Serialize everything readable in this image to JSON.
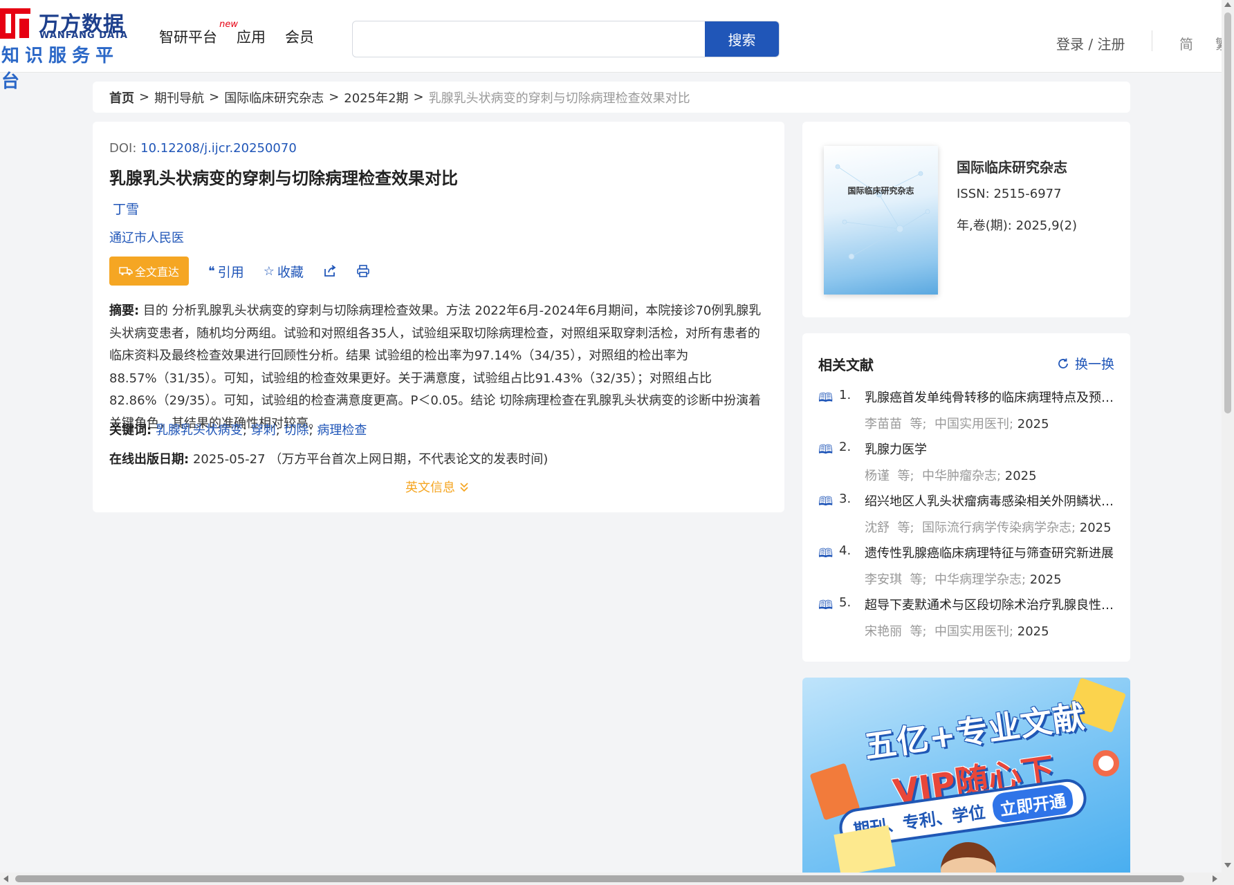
{
  "header": {
    "logo_cn": "万方数据",
    "logo_en": "WANFANG DATA",
    "logo_sub": "知识服务平台",
    "nav": [
      {
        "label": "智研平台",
        "badge": "new"
      },
      {
        "label": "应用"
      },
      {
        "label": "会员"
      }
    ],
    "search": {
      "value": "",
      "placeholder": "",
      "button": "搜索"
    },
    "login": "登录 / 注册",
    "lang_simplified": "简",
    "lang_traditional": "繁"
  },
  "breadcrumb": {
    "items": [
      "首页",
      "期刊导航",
      "国际临床研究杂志",
      "2025年2期"
    ],
    "current": "乳腺乳头状病变的穿刺与切除病理检查效果对比",
    "separator": ">"
  },
  "article": {
    "doi_label": "DOI: ",
    "doi": "10.12208/j.ijcr.20250070",
    "title": "乳腺乳头状病变的穿刺与切除病理检查效果对比",
    "author": "丁雪",
    "org": "通辽市人民医",
    "actions": {
      "fulltext": "全文直达",
      "cite": "引用",
      "favorite": "收藏"
    },
    "abstract_label": "摘要:",
    "abstract": " 目的 分析乳腺乳头状病变的穿刺与切除病理检查效果。方法 2022年6月-2024年6月期间，本院接诊70例乳腺乳头状病变患者，随机均分两组。试验和对照组各35人，试验组采取切除病理检查，对照组采取穿刺活检，对所有患者的临床资料及最终检查效果进行回顾性分析。结果 试验组的检出率为97.14%（34/35），对照组的检出率为88.57%（31/35）。可知，试验组的检查效果更好。关于满意度，试验组占比91.43%（32/35）；对照组占比82.86%（29/35）。可知，试验组的检查满意度更高。P＜0.05。结论 切除病理检查在乳腺乳头状病变的诊断中扮演着关键角色，其结果的准确性相对较高。",
    "keywords_label": "关键词:",
    "keywords": [
      "乳腺乳头状病变",
      "穿刺",
      "切除",
      "病理检查"
    ],
    "pubdate_label": "在线出版日期:",
    "pubdate": "2025-05-27",
    "pubdate_note": "（万方平台首次上网日期，不代表论文的发表时间)",
    "en_info": "英文信息"
  },
  "journal": {
    "cover_title": "国际临床研究杂志",
    "name": "国际临床研究杂志",
    "issn_label": "ISSN:",
    "issn": "2515-6977",
    "issue_label": "年,卷(期):",
    "issue": "2025,9(2)"
  },
  "related": {
    "heading": "相关文献",
    "refresh": "换一换",
    "items": [
      {
        "num": "1.",
        "title": "乳腺癌首发单纯骨转移的临床病理特点及预后分析",
        "author": "李苗苗",
        "etal": "等;",
        "source": "中国实用医刊",
        "year": "2025"
      },
      {
        "num": "2.",
        "title": "乳腺力医学",
        "author": "杨谨",
        "etal": "等;",
        "source": "中华肿瘤杂志",
        "year": "2025"
      },
      {
        "num": "3.",
        "title": "绍兴地区人乳头状瘤病毒感染相关外阴鳞状上皮病变",
        "author": "沈舒",
        "etal": "等;",
        "source": "国际流行病学传染病学杂志",
        "year": "2025"
      },
      {
        "num": "4.",
        "title": "遗传性乳腺癌临床病理特征与筛查研究新进展",
        "author": "李安琪",
        "etal": "等;",
        "source": "中华病理学杂志",
        "year": "2025"
      },
      {
        "num": "5.",
        "title": "超导下麦默通术与区段切除术治疗乳腺良性肿瘤",
        "author": "宋艳丽",
        "etal": "等;",
        "source": "中国实用医刊",
        "year": "2025"
      }
    ]
  },
  "banner": {
    "line1": "五亿+专业文献",
    "line2": "VIP随心下",
    "pill_text": "期刊、专利、学位",
    "cta": "立即开通"
  },
  "colors": {
    "brand_blue": "#2056b8",
    "accent_orange": "#f5a623",
    "logo_red": "#e60012"
  }
}
